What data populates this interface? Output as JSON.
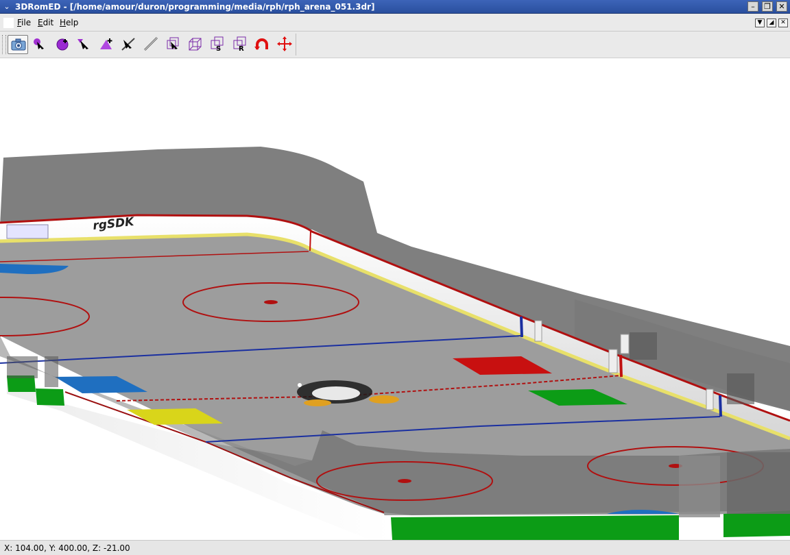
{
  "window": {
    "title": "3DRomED - [/home/amour/duron/programming/media/rph/rph_arena_051.3dr]",
    "sysmenu_icon": "chevron-down-icon",
    "controls": [
      "minimize-icon",
      "maximize-icon",
      "close-icon"
    ],
    "title_bar_color": "#3060b0"
  },
  "menubar": {
    "items": [
      {
        "label": "File",
        "mnemonic": "F"
      },
      {
        "label": "Edit",
        "mnemonic": "E"
      },
      {
        "label": "Help",
        "mnemonic": "H"
      }
    ],
    "mdi_controls": [
      "mdi-menu-icon",
      "mdi-restore-icon",
      "mdi-close-icon"
    ]
  },
  "toolbar": {
    "tools": [
      {
        "name": "camera-tool",
        "icon": "camera-icon",
        "active": true
      },
      {
        "name": "select-point-tool",
        "icon": "select-point-icon"
      },
      {
        "name": "add-point-tool",
        "icon": "add-point-icon"
      },
      {
        "name": "select-triangle-tool",
        "icon": "select-triangle-icon"
      },
      {
        "name": "add-triangle-tool",
        "icon": "add-triangle-icon"
      },
      {
        "name": "select-edge-tool",
        "icon": "select-edge-icon"
      },
      {
        "name": "line-tool",
        "icon": "line-icon"
      },
      {
        "name": "select-object-tool",
        "icon": "select-object-icon"
      },
      {
        "name": "box-tool",
        "icon": "box-icon"
      },
      {
        "name": "scale-tool",
        "icon": "scale-box-icon",
        "letter": "S"
      },
      {
        "name": "rotate-tool",
        "icon": "rotate-box-icon",
        "letter": "R"
      },
      {
        "name": "undo-tool",
        "icon": "undo-arc-icon"
      },
      {
        "name": "move-tool",
        "icon": "move-arrows-icon"
      }
    ]
  },
  "viewport": {
    "board_text": "rgSDK",
    "colors": {
      "ice": "#9a9a9a",
      "stands": "#7d7d7d",
      "board": "#f2f2f2",
      "kick_plate": "#e8e06a",
      "red_line": "#b01010",
      "blue_line": "#1a2fa0",
      "green_pad": "#0c9c16",
      "yellow_pad": "#d9d51a",
      "red_pad": "#c81010",
      "blue_pad": "#1f6fc0"
    }
  },
  "statusbar": {
    "coords": "X: 104.00, Y: 400.00, Z: -21.00"
  }
}
